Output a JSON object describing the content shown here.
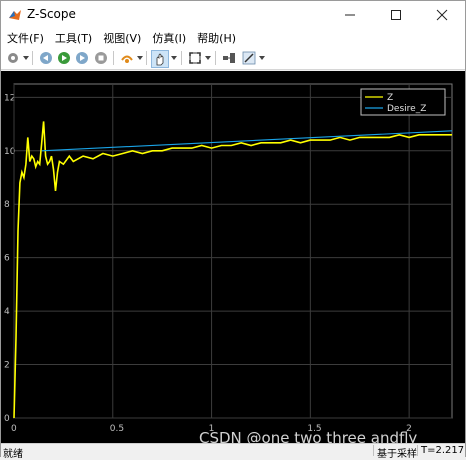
{
  "window": {
    "title": "Z-Scope"
  },
  "menu": {
    "items": [
      {
        "label": "文件(F)"
      },
      {
        "label": "工具(T)"
      },
      {
        "label": "视图(V)"
      },
      {
        "label": "仿真(I)"
      },
      {
        "label": "帮助(H)"
      }
    ]
  },
  "toolbar": {
    "icons": [
      "settings-icon",
      "step-back-icon",
      "run-icon",
      "step-forward-icon",
      "stop-icon",
      "highlight-icon",
      "pan-icon",
      "zoom-fit-icon",
      "cursor-measure-icon",
      "style-icon"
    ]
  },
  "colors": {
    "z_line": "#ffff00",
    "desire_line": "#1aa3e6",
    "plot_bg": "#000000",
    "grid": "#3c3c3c"
  },
  "chart_data": {
    "type": "line",
    "xlim": [
      0,
      2.217
    ],
    "ylim": [
      0,
      12.5
    ],
    "xticks": [
      "0",
      "0.5",
      "1",
      "1.5",
      "2"
    ],
    "xtick_values": [
      0,
      0.5,
      1,
      1.5,
      2
    ],
    "yticks": [
      "0",
      "2",
      "4",
      "6",
      "8",
      "10",
      "12"
    ],
    "ytick_values": [
      0,
      2,
      4,
      6,
      8,
      10,
      12
    ],
    "grid": true,
    "legend_position": "top-right",
    "series": [
      {
        "name": "Z",
        "points": [
          [
            0,
            0
          ],
          [
            0.01,
            3.0
          ],
          [
            0.02,
            7.0
          ],
          [
            0.03,
            8.8
          ],
          [
            0.04,
            9.2
          ],
          [
            0.05,
            9.0
          ],
          [
            0.06,
            9.5
          ],
          [
            0.07,
            10.5
          ],
          [
            0.08,
            9.6
          ],
          [
            0.09,
            9.8
          ],
          [
            0.1,
            9.7
          ],
          [
            0.11,
            9.4
          ],
          [
            0.12,
            9.6
          ],
          [
            0.13,
            9.5
          ],
          [
            0.14,
            10.3
          ],
          [
            0.15,
            11.1
          ],
          [
            0.16,
            9.8
          ],
          [
            0.17,
            9.5
          ],
          [
            0.18,
            9.6
          ],
          [
            0.19,
            9.8
          ],
          [
            0.2,
            9.3
          ],
          [
            0.21,
            8.5
          ],
          [
            0.22,
            9.2
          ],
          [
            0.23,
            9.6
          ],
          [
            0.25,
            9.5
          ],
          [
            0.28,
            9.8
          ],
          [
            0.3,
            9.6
          ],
          [
            0.35,
            9.8
          ],
          [
            0.4,
            9.7
          ],
          [
            0.45,
            9.9
          ],
          [
            0.5,
            9.8
          ],
          [
            0.55,
            9.9
          ],
          [
            0.6,
            10.0
          ],
          [
            0.65,
            9.9
          ],
          [
            0.7,
            10.0
          ],
          [
            0.75,
            10.0
          ],
          [
            0.8,
            10.1
          ],
          [
            0.85,
            10.1
          ],
          [
            0.9,
            10.1
          ],
          [
            0.95,
            10.2
          ],
          [
            1.0,
            10.1
          ],
          [
            1.05,
            10.2
          ],
          [
            1.1,
            10.2
          ],
          [
            1.15,
            10.3
          ],
          [
            1.2,
            10.2
          ],
          [
            1.25,
            10.3
          ],
          [
            1.3,
            10.3
          ],
          [
            1.35,
            10.3
          ],
          [
            1.4,
            10.4
          ],
          [
            1.45,
            10.3
          ],
          [
            1.5,
            10.4
          ],
          [
            1.55,
            10.4
          ],
          [
            1.6,
            10.4
          ],
          [
            1.65,
            10.5
          ],
          [
            1.7,
            10.4
          ],
          [
            1.75,
            10.5
          ],
          [
            1.8,
            10.5
          ],
          [
            1.85,
            10.5
          ],
          [
            1.9,
            10.5
          ],
          [
            1.95,
            10.6
          ],
          [
            2.0,
            10.5
          ],
          [
            2.05,
            10.6
          ],
          [
            2.1,
            10.6
          ],
          [
            2.15,
            10.6
          ],
          [
            2.217,
            10.6
          ]
        ]
      },
      {
        "name": "Desire_Z",
        "points": [
          [
            0.14,
            10.0
          ],
          [
            2.217,
            10.75
          ]
        ]
      }
    ]
  },
  "status": {
    "left": "就绪",
    "middle": "基于采样",
    "right": "T=2.217"
  },
  "watermark": "CSDN @one two three andfly"
}
